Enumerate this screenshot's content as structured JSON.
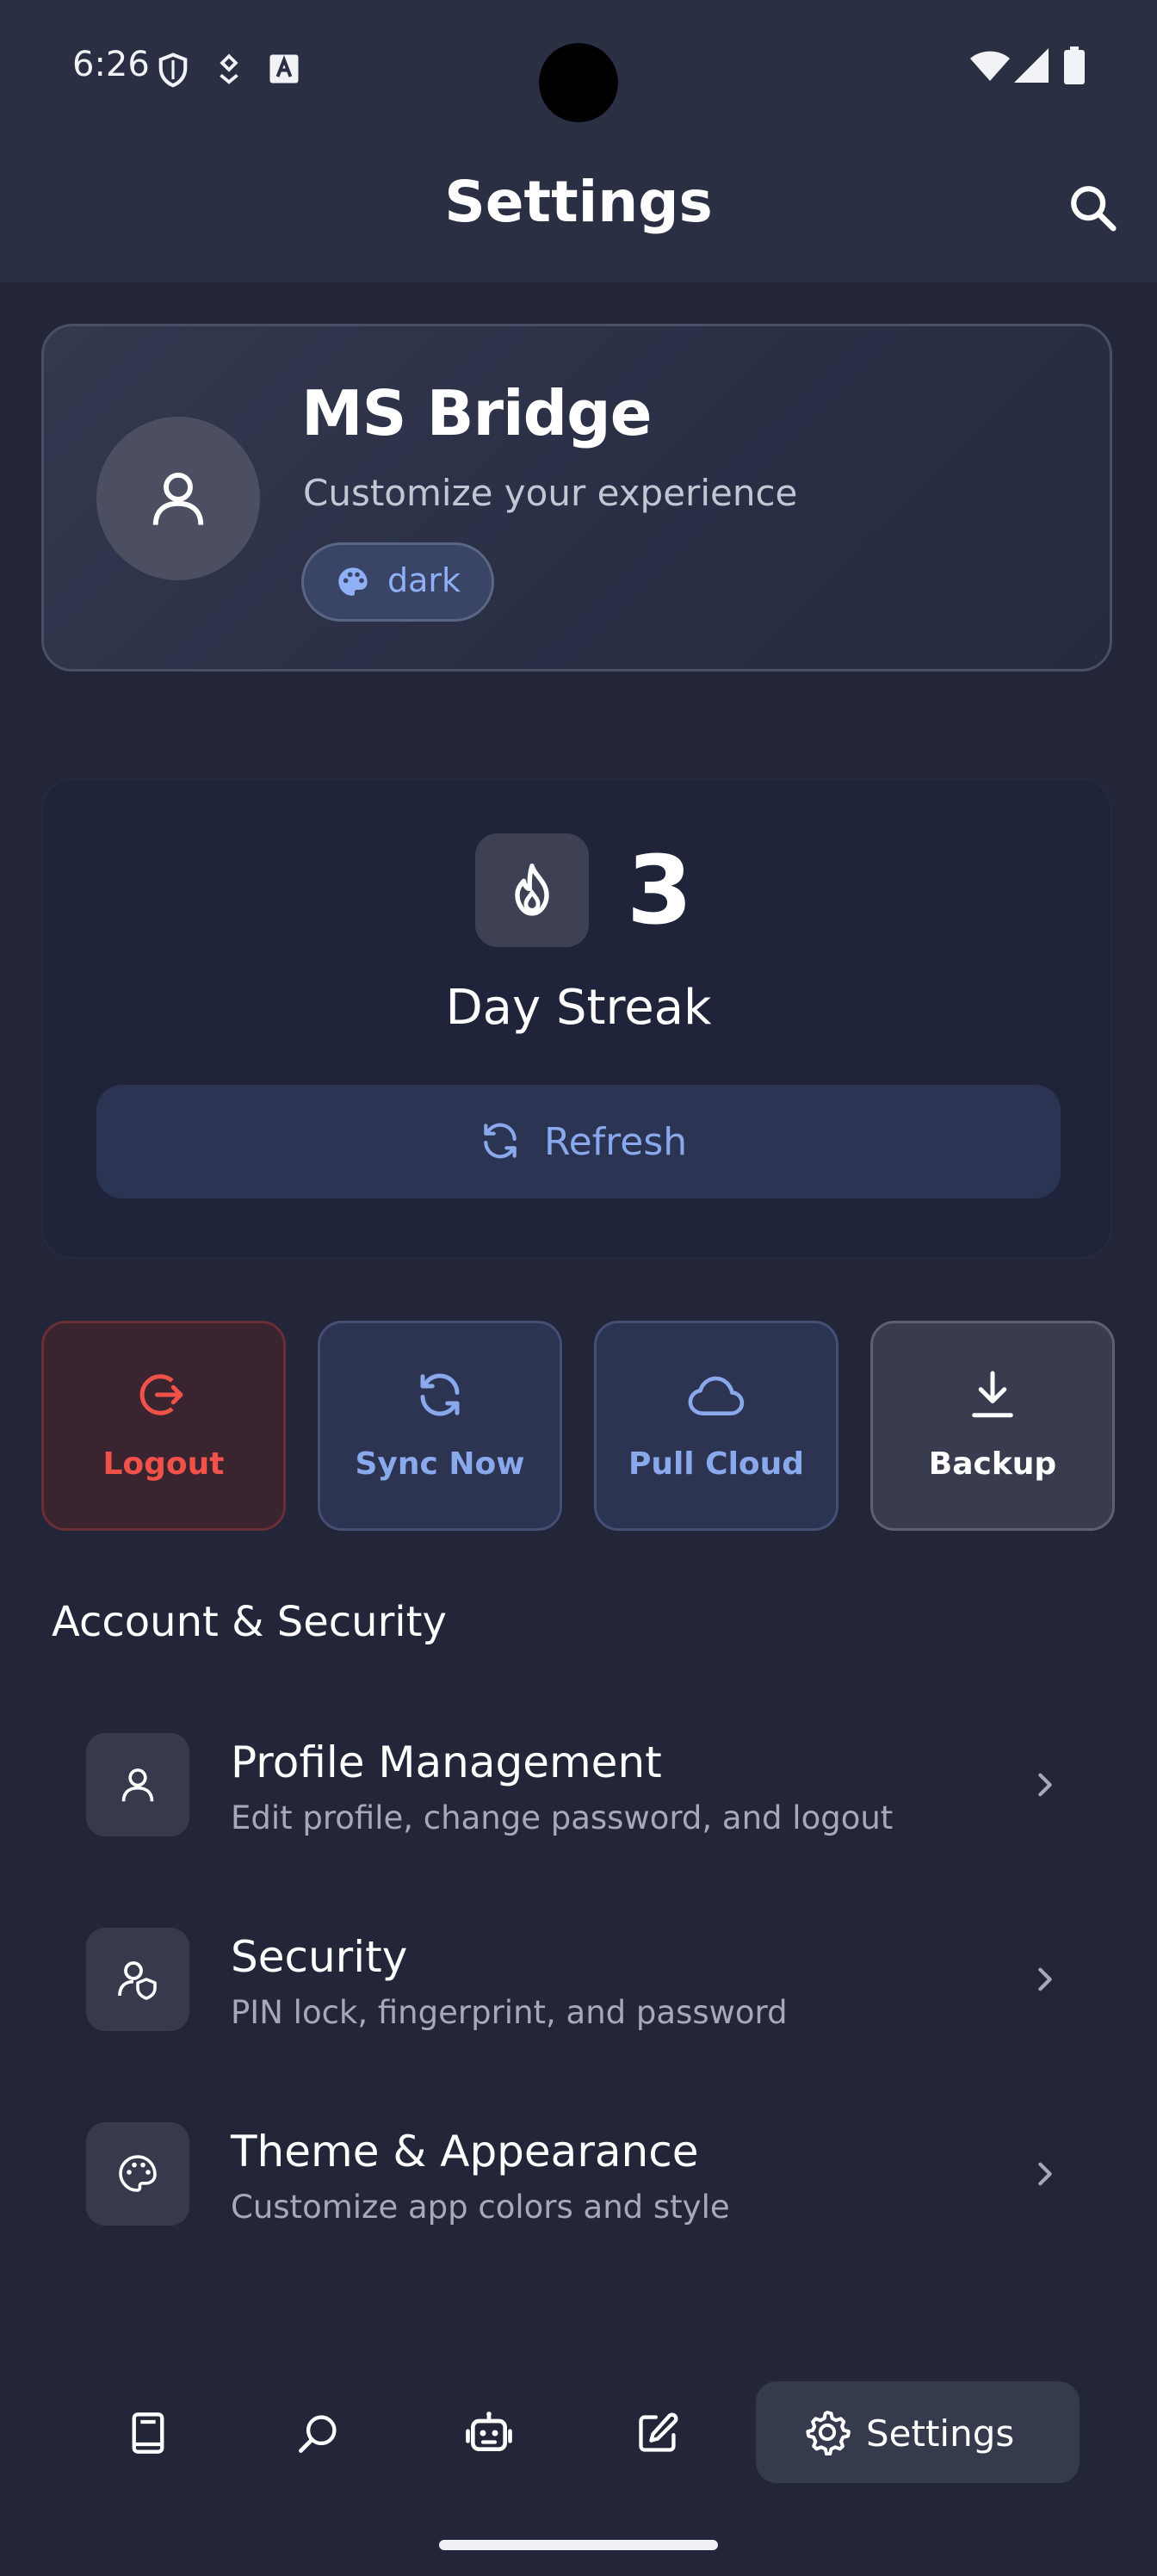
{
  "status_bar": {
    "time": "6:26",
    "icons": [
      "shield-icon",
      "vpn-key-icon",
      "a-box-icon",
      "wifi-icon",
      "signal-icon",
      "battery-icon"
    ]
  },
  "app_bar": {
    "title": "Settings",
    "search_icon": "search-icon"
  },
  "profile": {
    "name": "MS Bridge",
    "subtitle": "Customize your experience",
    "theme_chip": "dark"
  },
  "streak": {
    "count": "3",
    "label": "Day Streak",
    "refresh_label": "Refresh"
  },
  "actions": [
    {
      "label": "Logout",
      "icon": "logout-icon",
      "color": "#f0524a"
    },
    {
      "label": "Sync Now",
      "icon": "sync-icon",
      "color": "#8aa8ec"
    },
    {
      "label": "Pull Cloud",
      "icon": "cloud-icon",
      "color": "#8aa8ec"
    },
    {
      "label": "Backup",
      "icon": "download-icon",
      "color": "#ffffff"
    }
  ],
  "section": {
    "title": "Account & Security",
    "items": [
      {
        "title": "Profile Management",
        "subtitle": "Edit profile, change password, and logout",
        "icon": "person-icon"
      },
      {
        "title": "Security",
        "subtitle": "PIN lock, fingerprint, and password",
        "icon": "user-shield-icon"
      },
      {
        "title": "Theme & Appearance",
        "subtitle": "Customize app colors and style",
        "icon": "palette-icon"
      }
    ]
  },
  "bottom_nav": {
    "items": [
      "notes-icon",
      "search-icon",
      "robot-icon",
      "edit-icon",
      "settings-icon"
    ],
    "active_label": "Settings"
  },
  "colors": {
    "background": "#222638",
    "accent": "#8aa8ec",
    "danger": "#f0524a"
  }
}
